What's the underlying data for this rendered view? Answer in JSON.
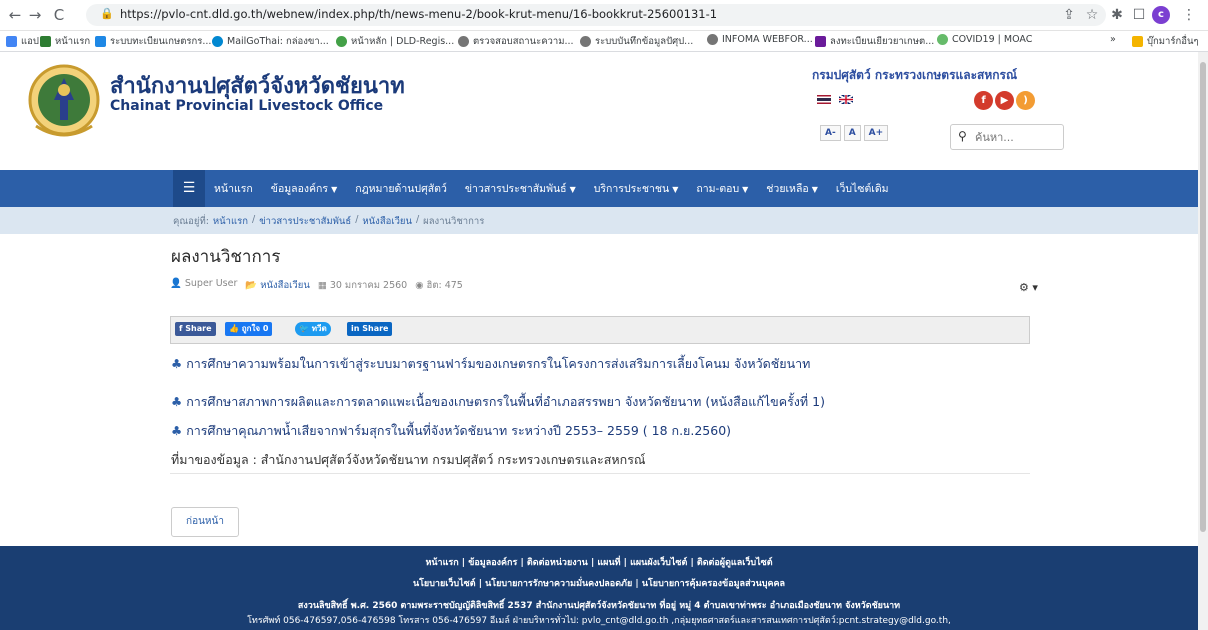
{
  "browser": {
    "url": "https://pvlo-cnt.dld.go.th/webnew/index.php/th/news-menu-2/book-krut-menu/16-bookkrut-25600131-1",
    "profile_initial": "c",
    "bookmarks": [
      {
        "label": "แอป",
        "color": "#4285f4"
      },
      {
        "label": "หน้าแรก",
        "color": "#2e7d32"
      },
      {
        "label": "ระบบทะเบียนเกษตรกร...",
        "color": "#1e88e5"
      },
      {
        "label": "MailGoThai: กล่องขา...",
        "color": "#0288d1"
      },
      {
        "label": "หน้าหลัก | DLD-Regis...",
        "color": "#43a047"
      },
      {
        "label": "ตรวจสอบสถานะความ...",
        "color": "#757575"
      },
      {
        "label": "ระบบบันทึกข้อมูลปัศุป...",
        "color": "#757575"
      },
      {
        "label": "INFOMA WEBFOR...",
        "color": "#757575"
      },
      {
        "label": "ลงทะเบียนเยียวยาเกษต...",
        "color": "#6a1b9a"
      },
      {
        "label": "COVID19 | MOAC",
        "color": "#66bb6a"
      }
    ],
    "other_bookmarks": "บุ๊กมาร์กอื่นๆ"
  },
  "header": {
    "title_th": "สำนักงานปศุสัตว์จังหวัดชัยนาท",
    "title_en": "Chainat Provincial Livestock Office",
    "department": "กรมปศุสัตว์  กระทรวงเกษตรและสหกรณ์",
    "font_sizes": [
      "A-",
      "A",
      "A+"
    ],
    "search_placeholder": "ค้นหา..."
  },
  "nav": {
    "items": [
      {
        "label": "หน้าแรก",
        "caret": false
      },
      {
        "label": "ข้อมูลองค์กร",
        "caret": true
      },
      {
        "label": "กฎหมายด้านปศุสัตว์",
        "caret": false
      },
      {
        "label": "ข่าวสารประชาสัมพันธ์",
        "caret": true
      },
      {
        "label": "บริการประชาชน",
        "caret": true
      },
      {
        "label": "ถาม-ตอบ",
        "caret": true
      },
      {
        "label": "ช่วยเหลือ",
        "caret": true
      },
      {
        "label": "เว็บไซต์เดิม",
        "caret": false
      }
    ]
  },
  "breadcrumb": {
    "prefix": "คุณอยู่ที่:",
    "items": [
      "หน้าแรก",
      "ข่าวสารประชาสัมพันธ์",
      "หนังสือเวียน",
      "ผลงานวิชาการ"
    ]
  },
  "article": {
    "title": "ผลงานวิชาการ",
    "author": "Super User",
    "category": "หนังสือเวียน",
    "date": "30 มกราคม 2560",
    "hits": "ฮิต: 475",
    "share": {
      "facebook": "Share",
      "like": "ถูกใจ 0",
      "tweet": "ทวีต",
      "linkedin": "Share"
    },
    "links": [
      "การศึกษาความพร้อมในการเข้าสู่ระบบมาตรฐานฟาร์มของเกษตรกรในโครงการส่งเสริมการเลี้ยงโคนม จังหวัดชัยนาท",
      "การศึกษาสภาพการผลิตและการตลาดแพะเนื้อของเกษตรกรในพื้นที่อำเภอสรรพยา  จังหวัดชัยนาท (หนังสือแก้ไขครั้งที่ 1)",
      "การศึกษาคุณภาพน้ำเสียจากฟาร์มสุกรในพื้นที่จังหวัดชัยนาท ระหว่างปี 2553– 2559 ( 18 ก.ย.2560)"
    ],
    "source": "ที่มาของข้อมูล : สำนักงานปศุสัตว์จังหวัดชัยนาท กรมปศุสัตว์ กระทรวงเกษตรและสหกรณ์",
    "prev_button": "ก่อนหน้า"
  },
  "footer": {
    "line1": "หน้าแรก | ข้อมูลองค์กร | ติดต่อหน่วยงาน | แผนที่ | แผนผังเว็บไซต์ | ติดต่อผู้ดูแลเว็บไซต์",
    "line2": "นโยบายเว็บไซต์ | นโยบายการรักษาความมั่นคงปลอดภัย | นโยบายการคุ้มครองข้อมูลส่วนบุคคล",
    "line3": "สงวนลิขสิทธิ์ พ.ศ. 2560 ตามพระราชบัญญัติลิขสิทธิ์ 2537 สำนักงานปศุสัตว์จังหวัดชัยนาท ที่อยู่ หมู่ 4 ตำบลเขาท่าพระ อำเภอเมืองชัยนาท จังหวัดชัยนาท",
    "line4": "โทรศัพท์ 056-476597,056-476598  โทรสาร 056-476597 อีเมล์ ฝ่ายบริหารทั่วไป: pvlo_cnt@dld.go.th ,กลุ่มยุทธศาสตร์และสารสนเทศการปศุสัตว์:pcnt.strategy@dld.go.th,"
  }
}
